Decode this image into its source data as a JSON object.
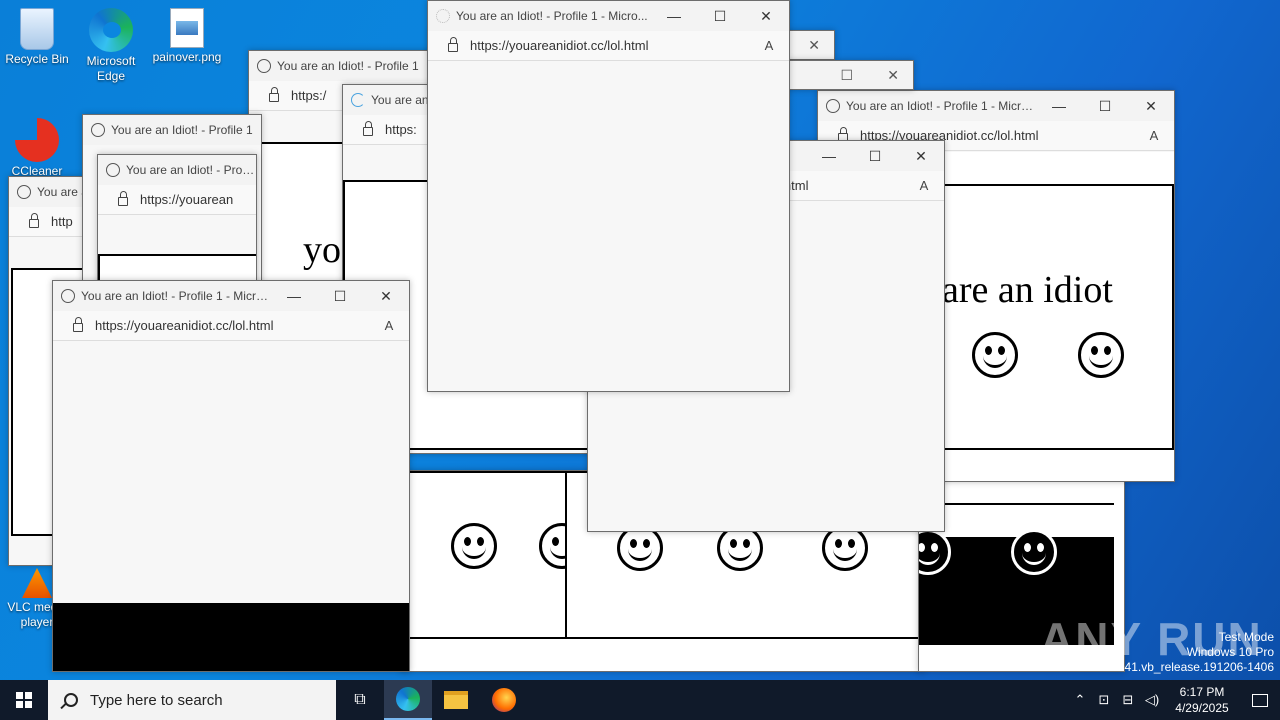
{
  "desktop": {
    "icons": [
      {
        "label": "Recycle Bin"
      },
      {
        "label": "Microsoft Edge"
      },
      {
        "label": "painover.png"
      },
      {
        "label": "CCleaner"
      },
      {
        "label": "VLC media player"
      }
    ]
  },
  "window_title": "You are an Idiot! - Profile 1 - Micro...",
  "window_title_short": "You are an Idiot! - Profile 1",
  "window_title_tiny": "You are an",
  "window_title_min": "Yo",
  "url_full": "https://youareanidiot.cc/lol.html",
  "url_part": "https://youarean",
  "url_tail": "lol.html",
  "url_https": "https:",
  "url_http": "http",
  "url_short": "https:/",
  "page_text": "you are an idiot",
  "page_text_frag": "are an idiot",
  "page_text_yo": "yo",
  "taskbar": {
    "search_placeholder": "Type here to search",
    "time": "6:17 PM",
    "date": "4/29/2025"
  },
  "watermark": {
    "line1": "Test Mode",
    "line2": "Windows 10 Pro",
    "line3": "Build 19041.vb_release.191206-1406",
    "brand": "ANY RUN"
  },
  "colors": {
    "desktop": "#0b86df",
    "taskbar": "#101a2a"
  }
}
